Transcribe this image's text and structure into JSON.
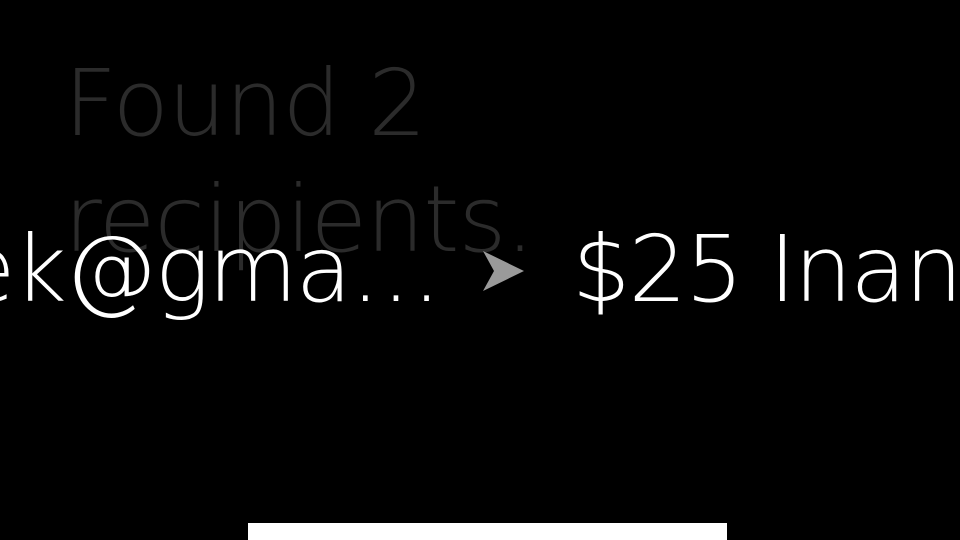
{
  "heading": {
    "line1": "Found 2",
    "line2": "recipients."
  },
  "recipient": {
    "address": "ek@gma…",
    "amount_and_name": "$25 Inan"
  },
  "icons": {
    "send_arrow": "send-arrow-icon"
  },
  "colors": {
    "background": "#000000",
    "heading_text": "#2b2b2b",
    "primary_text": "#ffffff",
    "arrow": "#9a9a9a"
  }
}
